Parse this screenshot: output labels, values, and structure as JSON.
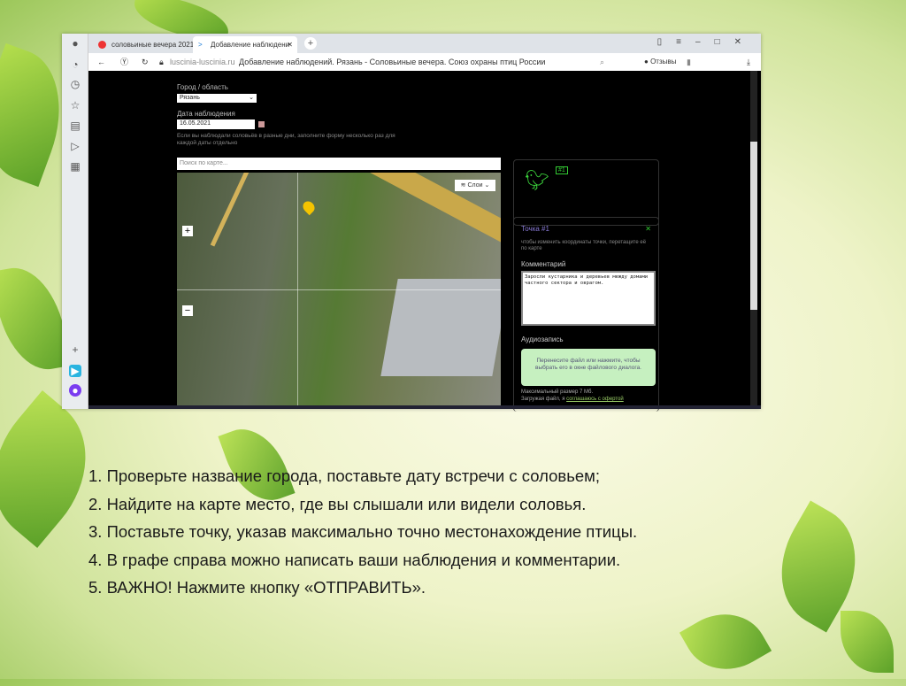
{
  "browser": {
    "tabs": [
      {
        "label": "соловьиные вечера 2021"
      },
      {
        "label": "Добавление наблюдени"
      }
    ],
    "url": "luscinia-luscinia.ru",
    "page_title": "Добавление наблюдений. Рязань - Соловьиные вечера. Союз охраны птиц России",
    "reviews_label": "Отзывы"
  },
  "form": {
    "city_label": "Город / область",
    "city_value": "Рязань",
    "date_label": "Дата наблюдения",
    "date_value": "16.05.2021",
    "hint": "Если вы наблюдали соловьёв в разные дни, заполните форму несколько раз для каждой даты отдельно",
    "search_placeholder": "Поиск по карте...",
    "layers_label": "Слои"
  },
  "point": {
    "badge": "#1",
    "title": "Точка #1",
    "hint": "чтобы изменить координаты точки, перетащите её по карте",
    "comment_label": "Комментарий",
    "comment_value": "Заросли кустарника и деревьев между домами частного сектора и оврагом.",
    "audio_label": "Аудиозапись",
    "drop_text": "Перенесите файл или нажмите, чтобы выбрать его в окне файлового диалога.",
    "max_size": "Максимальный размер 7 Мб.",
    "agree_prefix": "Загружая файл, я ",
    "agree_link": "соглашаюсь с офертой"
  },
  "instructions": [
    "1.   Проверьте название города, поставьте дату встречи с соловьем;",
    "2.   Найдите на карте место, где вы слышали или видели соловья.",
    "3.    Поставьте точку, указав максимально точно местонахождение птицы.",
    "4.   В графе справа можно  написать ваши наблюдения и комментарии.",
    "5.   ВАЖНО! Нажмите кнопку «ОТПРАВИТЬ»."
  ]
}
